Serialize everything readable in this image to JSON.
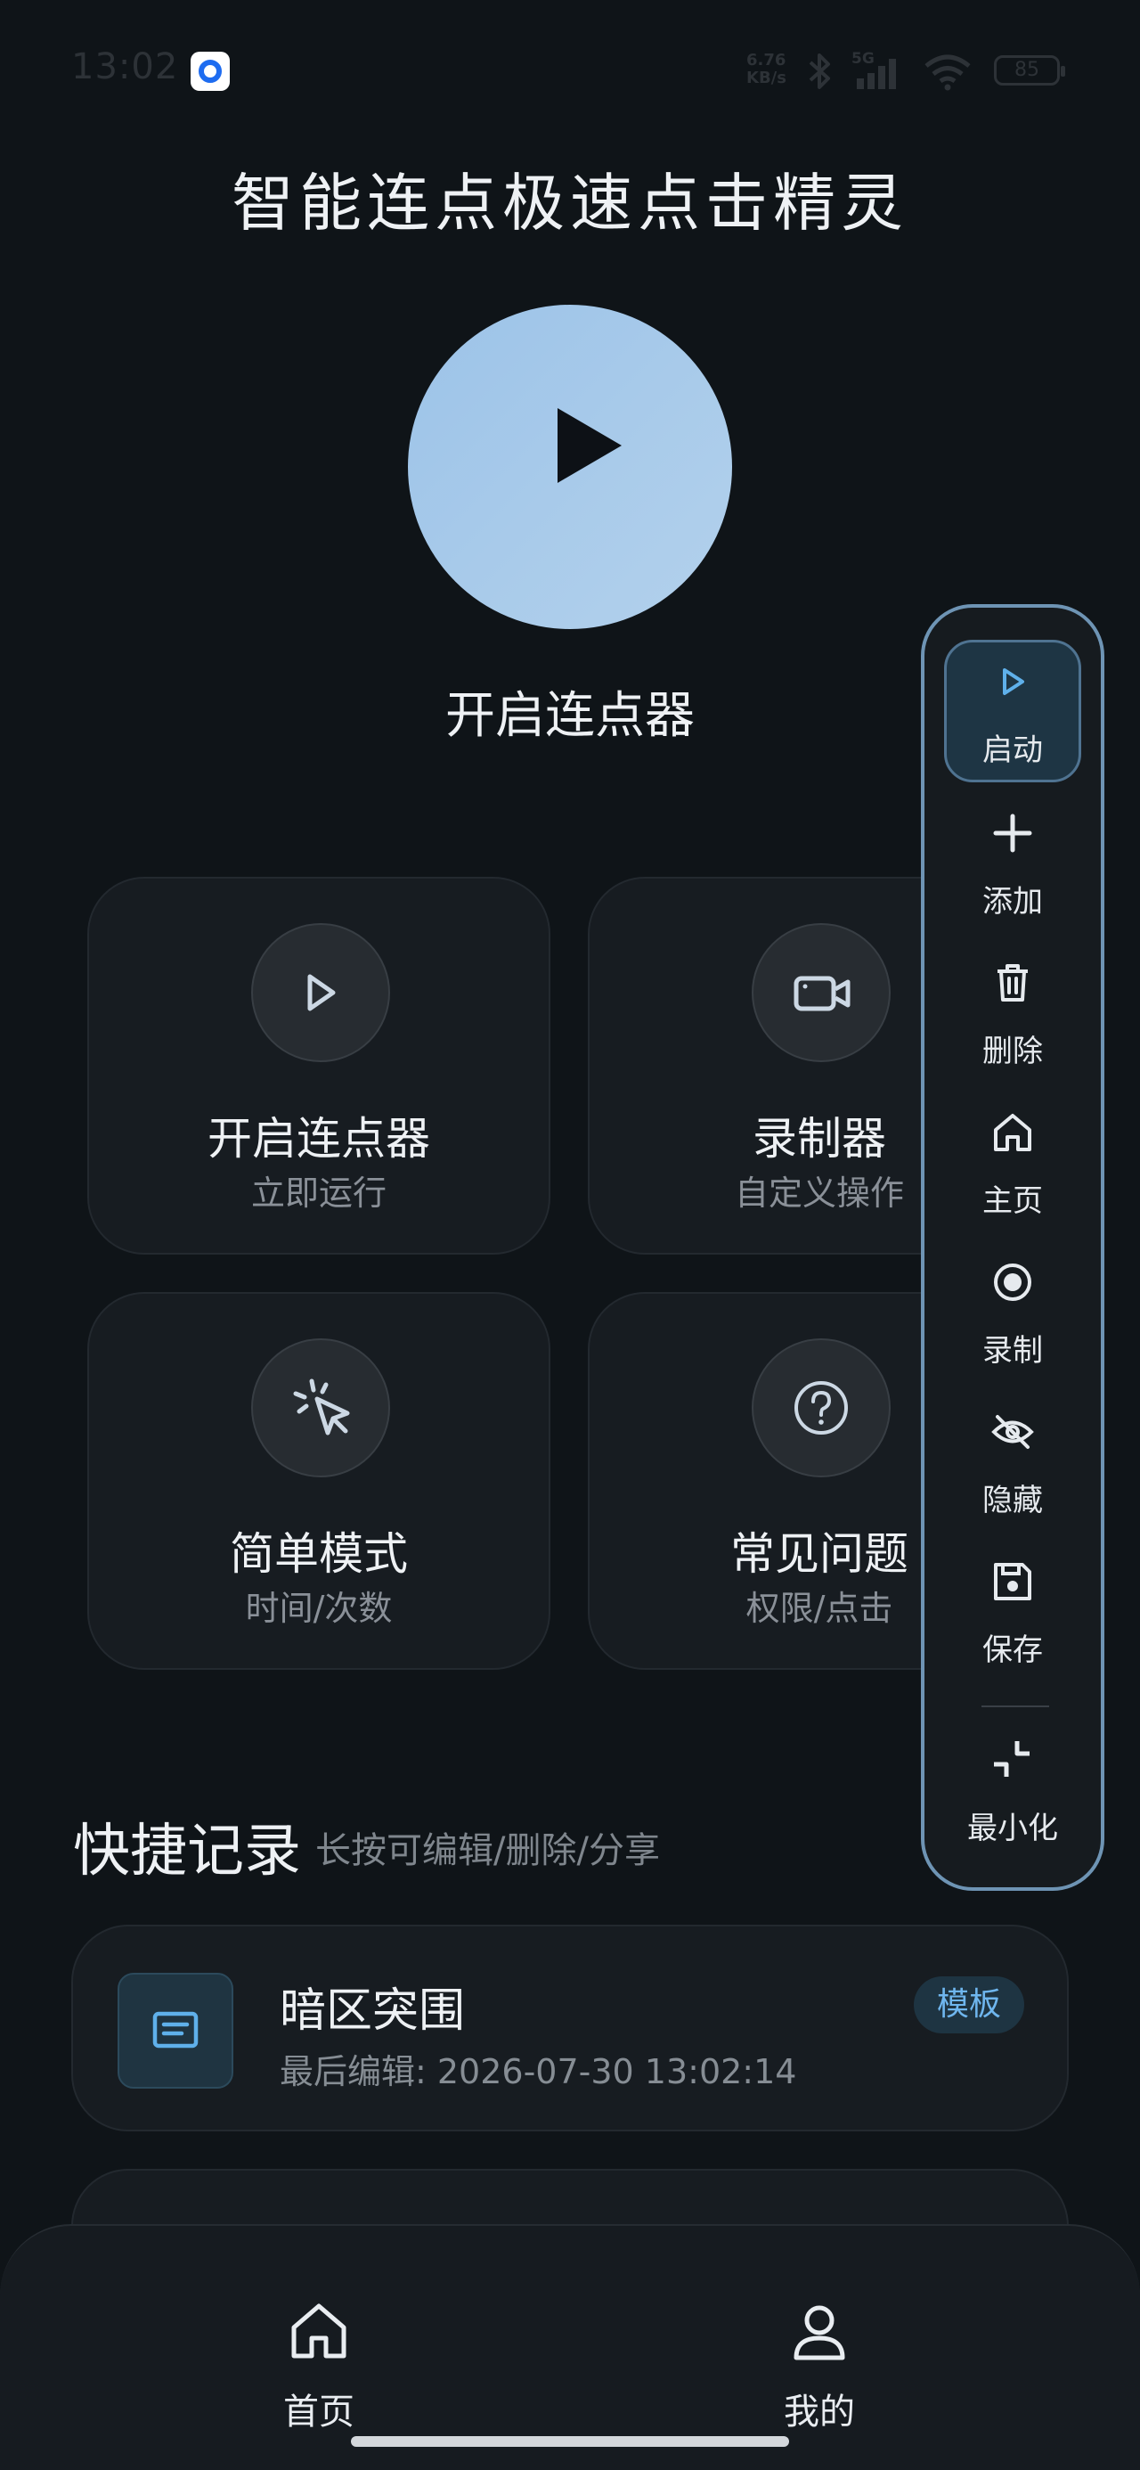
{
  "status_bar": {
    "time": "13:02",
    "net_speed_value": "6.76",
    "net_speed_unit": "KB/s",
    "signal_label": "5G",
    "battery": "85"
  },
  "app_title": "智能连点极速点击精灵",
  "main_button": {
    "label": "开启连点器",
    "icon": "play-icon"
  },
  "cards": [
    {
      "title": "开启连点器",
      "subtitle": "立即运行",
      "icon": "play-outline-icon"
    },
    {
      "title": "录制器",
      "subtitle": "自定义操作",
      "icon": "video-camera-icon"
    },
    {
      "title": "简单模式",
      "subtitle": "时间/次数",
      "icon": "cursor-click-icon"
    },
    {
      "title": "常见问题",
      "subtitle": "权限/点击",
      "icon": "question-circle-icon"
    }
  ],
  "quick_records": {
    "title": "快捷记录",
    "hint": "长按可编辑/删除/分享",
    "items": [
      {
        "name": "暗区突围",
        "last_edit": "最后编辑: 2026-07-30 13:02:14",
        "badge": "模板",
        "icon": "document-icon"
      }
    ]
  },
  "floating_panel": {
    "items": [
      {
        "label": "启动",
        "icon": "play-outline-icon",
        "active": true
      },
      {
        "label": "添加",
        "icon": "plus-icon"
      },
      {
        "label": "删除",
        "icon": "trash-icon"
      },
      {
        "label": "主页",
        "icon": "home-icon"
      },
      {
        "label": "录制",
        "icon": "record-icon"
      },
      {
        "label": "隐藏",
        "icon": "eye-off-icon"
      },
      {
        "label": "保存",
        "icon": "save-icon"
      },
      {
        "label": "最小化",
        "icon": "minimize-icon"
      }
    ],
    "colors": {
      "border": "#6e94b4",
      "active_bg": "#1e3544",
      "accent": "#6fb6ee"
    }
  },
  "bottom_nav": {
    "items": [
      {
        "label": "首页",
        "icon": "home-icon"
      },
      {
        "label": "我的",
        "icon": "user-icon"
      }
    ]
  }
}
